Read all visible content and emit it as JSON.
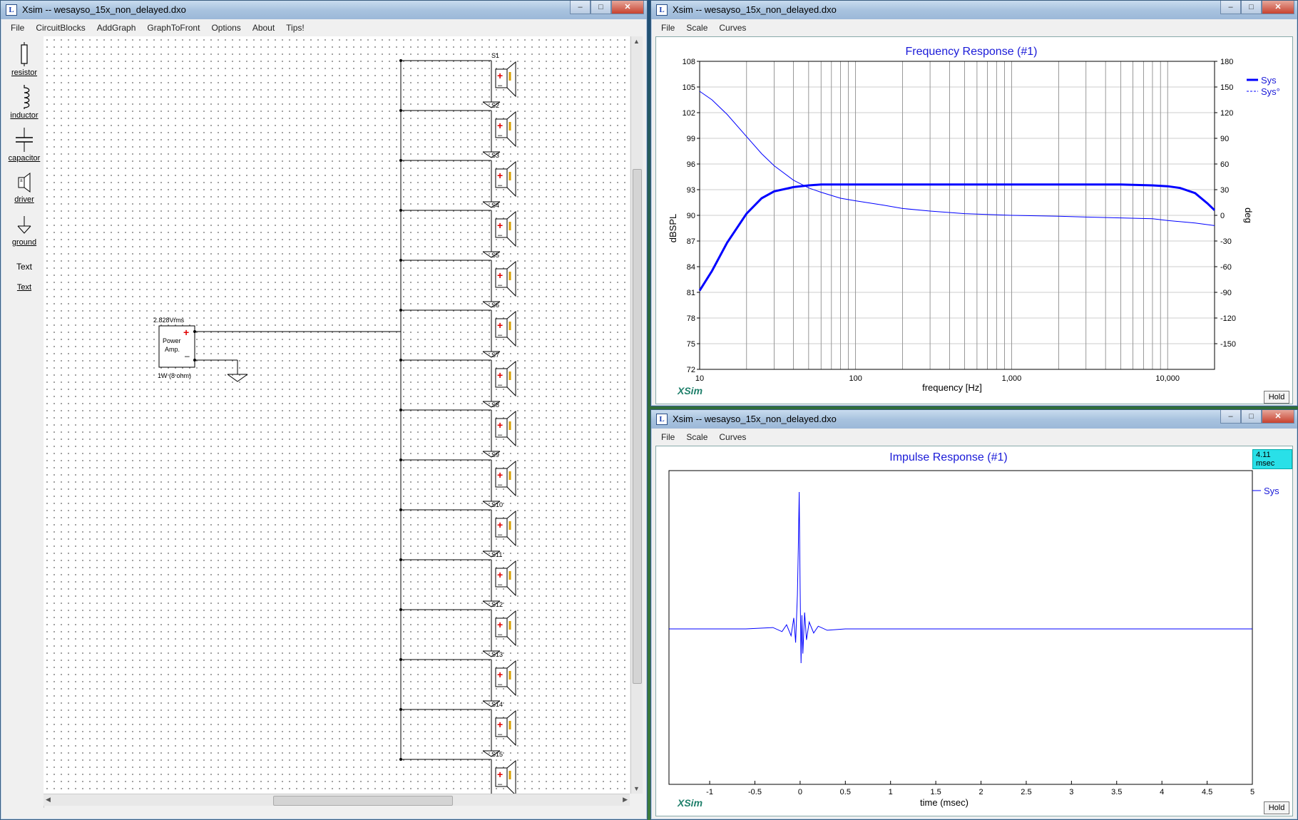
{
  "left_window": {
    "title": "Xsim -- wesayso_15x_non_delayed.dxo",
    "menu": [
      "File",
      "CircuitBlocks",
      "AddGraph",
      "GraphToFront",
      "Options",
      "About",
      "Tips!"
    ],
    "palette": [
      {
        "label": "resistor",
        "icon": "resistor-icon"
      },
      {
        "label": "inductor",
        "icon": "inductor-icon"
      },
      {
        "label": "capacitor",
        "icon": "capacitor-icon"
      },
      {
        "label": "driver",
        "icon": "driver-icon"
      },
      {
        "label": "ground",
        "icon": "ground-icon"
      },
      {
        "label": "Text",
        "icon": "text-tool"
      },
      {
        "label": "Text",
        "icon": "text-tool-underlined"
      }
    ],
    "amp": {
      "voltage": "2.828Vrms",
      "name_line1": "Power",
      "name_line2": "Amp.",
      "rating": "1W (8 ohm)"
    },
    "drivers": [
      "S1",
      "S2",
      "S3",
      "S4",
      "S5",
      "S6",
      "S7",
      "S8",
      "S9",
      "S10",
      "S11",
      "S12",
      "S13",
      "S14",
      "S15"
    ]
  },
  "freq_window": {
    "title": "Xsim -- wesayso_15x_non_delayed.dxo",
    "menu": [
      "File",
      "Scale",
      "Curves"
    ],
    "graph_title": "Frequency Response (#1)",
    "xlabel": "frequency [Hz]",
    "ylabel_left": "dBSPL",
    "ylabel_right": "deg",
    "legend": [
      "Sys",
      "Sys°"
    ],
    "logo": "XSim",
    "hold": "Hold"
  },
  "impulse_window": {
    "title": "Xsim -- wesayso_15x_non_delayed.dxo",
    "menu": [
      "File",
      "Scale",
      "Curves"
    ],
    "graph_title": "Impulse Response (#1)",
    "xlabel": "time (msec)",
    "legend": [
      "Sys"
    ],
    "cursor_readout": "4.11 msec",
    "logo": "XSim",
    "hold": "Hold"
  },
  "chart_data": [
    {
      "type": "line",
      "title": "Frequency Response (#1)",
      "xlabel": "frequency [Hz]",
      "ylabel": "dBSPL",
      "y2label": "deg",
      "xscale": "log",
      "xlim": [
        10,
        20000
      ],
      "ylim": [
        72,
        108
      ],
      "y2lim": [
        -180,
        180
      ],
      "x_ticks": [
        "10",
        "100",
        "1,000",
        "10,000"
      ],
      "y_ticks": [
        72,
        75,
        78,
        81,
        84,
        87,
        90,
        93,
        96,
        99,
        102,
        105,
        108
      ],
      "y2_ticks": [
        -150,
        -120,
        -90,
        -60,
        -30,
        0,
        30,
        60,
        90,
        120,
        150,
        180
      ],
      "legend_position": "top-right",
      "grid": true,
      "series": [
        {
          "name": "Sys",
          "axis": "left",
          "color": "#0000ff",
          "style": "solid-thick",
          "x": [
            10,
            12,
            15,
            20,
            25,
            30,
            40,
            50,
            60,
            80,
            100,
            200,
            500,
            1000,
            2000,
            5000,
            8000,
            10000,
            12000,
            15000,
            18000,
            20000
          ],
          "y": [
            81.2,
            83.5,
            86.8,
            90.2,
            92.0,
            92.8,
            93.3,
            93.5,
            93.6,
            93.6,
            93.6,
            93.6,
            93.6,
            93.6,
            93.6,
            93.6,
            93.5,
            93.4,
            93.2,
            92.6,
            91.4,
            90.6
          ]
        },
        {
          "name": "Sys°",
          "axis": "right",
          "color": "#0000ff",
          "style": "thin",
          "x": [
            10,
            12,
            15,
            20,
            25,
            30,
            40,
            50,
            60,
            80,
            100,
            150,
            200,
            300,
            500,
            1000,
            2000,
            3000,
            5000,
            8000,
            10000,
            15000,
            20000
          ],
          "y": [
            145,
            135,
            118,
            92,
            72,
            58,
            41,
            32,
            27,
            20,
            17,
            12,
            8,
            5,
            2,
            0,
            -1,
            -2,
            -3,
            -4,
            -6,
            -9,
            -12
          ]
        }
      ]
    },
    {
      "type": "line",
      "title": "Impulse Response (#1)",
      "xlabel": "time (msec)",
      "xlim": [
        -1.45,
        5
      ],
      "x_ticks": [
        "-1",
        "-0.5",
        "0",
        "0.5",
        "1",
        "1.5",
        "2",
        "2.5",
        "3",
        "3.5",
        "4",
        "4.5",
        "5"
      ],
      "legend_position": "top-right",
      "grid": false,
      "series": [
        {
          "name": "Sys",
          "color": "#0000ff",
          "x": [
            -1.45,
            -0.6,
            -0.3,
            -0.2,
            -0.15,
            -0.1,
            -0.07,
            -0.05,
            -0.03,
            -0.02,
            -0.01,
            0,
            0.01,
            0.02,
            0.03,
            0.05,
            0.07,
            0.1,
            0.15,
            0.2,
            0.3,
            0.5,
            5
          ],
          "y": [
            0,
            0,
            0.01,
            -0.02,
            0.03,
            -0.05,
            0.08,
            -0.1,
            0.25,
            0.6,
            1.0,
            0.3,
            -0.25,
            0.1,
            -0.18,
            0.12,
            -0.08,
            0.05,
            -0.03,
            0.02,
            -0.01,
            0,
            0
          ]
        }
      ]
    }
  ]
}
